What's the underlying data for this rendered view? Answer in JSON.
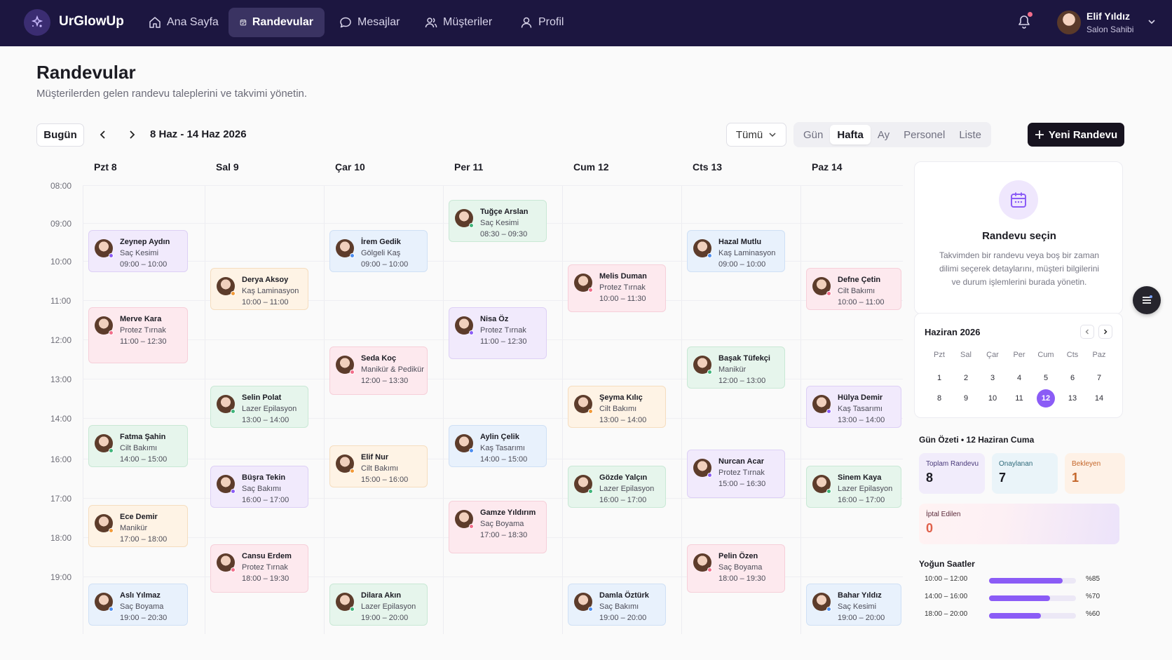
{
  "app": {
    "name": "UrGlowUp"
  },
  "nav": [
    {
      "label": "Ana Sayfa",
      "icon": "home-icon"
    },
    {
      "label": "Randevular",
      "icon": "calendar-icon",
      "active": true
    },
    {
      "label": "Mesajlar",
      "icon": "message-icon"
    },
    {
      "label": "Müşteriler",
      "icon": "users-icon"
    },
    {
      "label": "Profil",
      "icon": "user-icon"
    }
  ],
  "user": {
    "name": "Elif Yıldız",
    "role": "Salon Sahibi"
  },
  "page": {
    "title": "Randevular",
    "subtitle": "Müşterilerden gelen randevu taleplerini ve takvimi yönetin."
  },
  "toolbar": {
    "today": "Bugün",
    "range": "8 Haz - 14 Haz 2026",
    "filter": "Tümü",
    "views": [
      "Gün",
      "Hafta",
      "Ay",
      "Personel",
      "Liste"
    ],
    "active_view": "Hafta",
    "new_button": "Yeni Randevu"
  },
  "days": [
    "Pzt 8",
    "Sal 9",
    "Çar 10",
    "Per 11",
    "Cum 12",
    "Cts 13",
    "Paz 14"
  ],
  "hours": [
    "08:00",
    "09:00",
    "10:00",
    "11:00",
    "12:00",
    "13:00",
    "14:00",
    "16:00",
    "17:00",
    "18:00",
    "19:00"
  ],
  "events": [
    {
      "day": 0,
      "start": 9,
      "end": 10,
      "name": "Zeynep Aydın",
      "service": "Saç Kesimi",
      "time": "09:00 – 10:00",
      "color": "purple"
    },
    {
      "day": 0,
      "start": 11,
      "end": 12.5,
      "name": "Merve Kara",
      "service": "Protez Tırnak",
      "time": "11:00 – 12:30",
      "color": "pink"
    },
    {
      "day": 0,
      "start": 14,
      "end": 15,
      "name": "Fatma Şahin",
      "service": "Cilt Bakımı",
      "time": "14:00 – 15:00",
      "color": "green"
    },
    {
      "day": 0,
      "start": 17,
      "end": 18,
      "name": "Ece Demir",
      "service": "Manikür",
      "time": "17:00 – 18:00",
      "color": "orange"
    },
    {
      "day": 0,
      "start": 19,
      "end": 20,
      "name": "Aslı Yılmaz",
      "service": "Saç Boyama",
      "time": "19:00 – 20:30",
      "color": "blue"
    },
    {
      "day": 1,
      "start": 10,
      "end": 11,
      "name": "Derya Aksoy",
      "service": "Kaş Laminasyon",
      "time": "10:00 – 11:00",
      "color": "orange"
    },
    {
      "day": 1,
      "start": 13,
      "end": 14,
      "name": "Selin Polat",
      "service": "Lazer Epilasyon",
      "time": "13:00 – 14:00",
      "color": "green"
    },
    {
      "day": 1,
      "start": 16,
      "end": 17,
      "name": "Büşra Tekin",
      "service": "Saç Bakımı",
      "time": "16:00 – 17:00",
      "color": "purple"
    },
    {
      "day": 1,
      "start": 18,
      "end": 19.3,
      "name": "Cansu Erdem",
      "service": "Protez Tırnak",
      "time": "18:00 – 19:30",
      "color": "pink"
    },
    {
      "day": 2,
      "start": 9,
      "end": 10,
      "name": "İrem Gedik",
      "service": "Gölgeli Kaş",
      "time": "09:00 – 10:00",
      "color": "blue"
    },
    {
      "day": 2,
      "start": 12,
      "end": 13.3,
      "name": "Seda Koç",
      "service": "Manikür & Pedikür",
      "time": "12:00 – 13:30",
      "color": "pink"
    },
    {
      "day": 2,
      "start": 15,
      "end": 16,
      "name": "Elif Nur",
      "service": "Cilt Bakımı",
      "time": "15:00 – 16:00",
      "color": "orange"
    },
    {
      "day": 2,
      "start": 19,
      "end": 20,
      "name": "Dilara Akın",
      "service": "Lazer Epilasyon",
      "time": "19:00 – 20:00",
      "color": "green"
    },
    {
      "day": 3,
      "start": 8.2,
      "end": 9.3,
      "name": "Tuğçe Arslan",
      "service": "Saç Kesimi",
      "time": "08:30 – 09:30",
      "color": "green"
    },
    {
      "day": 3,
      "start": 11,
      "end": 12.4,
      "name": "Nisa Öz",
      "service": "Protez Tırnak",
      "time": "11:00 – 12:30",
      "color": "purple"
    },
    {
      "day": 3,
      "start": 14,
      "end": 15,
      "name": "Aylin Çelik",
      "service": "Kaş Tasarımı",
      "time": "14:00 – 15:00",
      "color": "blue"
    },
    {
      "day": 3,
      "start": 16.9,
      "end": 18.3,
      "name": "Gamze Yıldırım",
      "service": "Saç Boyama",
      "time": "17:00 – 18:30",
      "color": "pink"
    },
    {
      "day": 4,
      "start": 9.9,
      "end": 11.2,
      "name": "Melis Duman",
      "service": "Protez Tırnak",
      "time": "10:00 – 11:30",
      "color": "pink"
    },
    {
      "day": 4,
      "start": 13,
      "end": 14,
      "name": "Şeyma Kılıç",
      "service": "Cilt Bakımı",
      "time": "13:00 – 14:00",
      "color": "orange"
    },
    {
      "day": 4,
      "start": 16,
      "end": 17,
      "name": "Gözde Yalçın",
      "service": "Lazer Epilasyon",
      "time": "16:00 – 17:00",
      "color": "green"
    },
    {
      "day": 4,
      "start": 19,
      "end": 20,
      "name": "Damla Öztürk",
      "service": "Saç Bakımı",
      "time": "19:00 – 20:00",
      "color": "blue"
    },
    {
      "day": 5,
      "start": 9,
      "end": 10,
      "name": "Hazal Mutlu",
      "service": "Kaş Laminasyon",
      "time": "09:00 – 10:00",
      "color": "blue"
    },
    {
      "day": 5,
      "start": 12,
      "end": 13,
      "name": "Başak Tüfekçi",
      "service": "Manikür",
      "time": "12:00 – 13:00",
      "color": "green"
    },
    {
      "day": 5,
      "start": 15.2,
      "end": 16.9,
      "name": "Nurcan Acar",
      "service": "Protez Tırnak",
      "time": "15:00 – 16:30",
      "color": "purple"
    },
    {
      "day": 5,
      "start": 18,
      "end": 19.3,
      "name": "Pelin Özen",
      "service": "Saç Boyama",
      "time": "18:00 – 19:30",
      "color": "pink"
    },
    {
      "day": 6,
      "start": 10,
      "end": 11,
      "name": "Defne Çetin",
      "service": "Cilt Bakımı",
      "time": "10:00 – 11:00",
      "color": "pink"
    },
    {
      "day": 6,
      "start": 13,
      "end": 14,
      "name": "Hülya Demir",
      "service": "Kaş Tasarımı",
      "time": "13:00 – 14:00",
      "color": "purple"
    },
    {
      "day": 6,
      "start": 16,
      "end": 17,
      "name": "Sinem Kaya",
      "service": "Lazer Epilasyon",
      "time": "16:00 – 17:00",
      "color": "green"
    },
    {
      "day": 6,
      "start": 19,
      "end": 20,
      "name": "Bahar Yıldız",
      "service": "Saç Kesimi",
      "time": "19:00 – 20:00",
      "color": "blue"
    }
  ],
  "colors": {
    "nav_bg": "#1c1640",
    "accent": "#8b5cf6",
    "status_dots": [
      "#8b5cf6",
      "#f26d8a",
      "#3fb57a",
      "#f29a38",
      "#4c8ef0"
    ]
  },
  "detail_panel": {
    "title": "Randevu seçin",
    "description": "Takvimden bir randevu veya boş bir zaman dilimi seçerek detaylarını, müşteri bilgilerini ve durum işlemlerini burada yönetin."
  },
  "mini_calendar": {
    "title": "Haziran 2026",
    "weekdays": [
      "Pzt",
      "Sal",
      "Çar",
      "Per",
      "Cum",
      "Cts",
      "Paz"
    ],
    "weeks": [
      [
        "1",
        "2",
        "3",
        "4",
        "5",
        "6",
        "7"
      ],
      [
        "8",
        "9",
        "10",
        "11",
        "12",
        "13",
        "14"
      ]
    ],
    "selected": "12"
  },
  "summary": {
    "title": "Gün Özeti • 12 Haziran Cuma",
    "stats": [
      {
        "label": "Toplam Randevu",
        "value": "8"
      },
      {
        "label": "Onaylanan",
        "value": "7"
      },
      {
        "label": "Bekleyen",
        "value": "1"
      },
      {
        "label": "İptal Edilen",
        "value": "0"
      }
    ]
  },
  "busy": {
    "title": "Yoğun Saatler",
    "rows": [
      {
        "range": "10:00 – 12:00",
        "percent": 85,
        "label": "%85"
      },
      {
        "range": "14:00 – 16:00",
        "percent": 70,
        "label": "%70"
      },
      {
        "range": "18:00 – 20:00",
        "percent": 60,
        "label": "%60"
      }
    ]
  }
}
